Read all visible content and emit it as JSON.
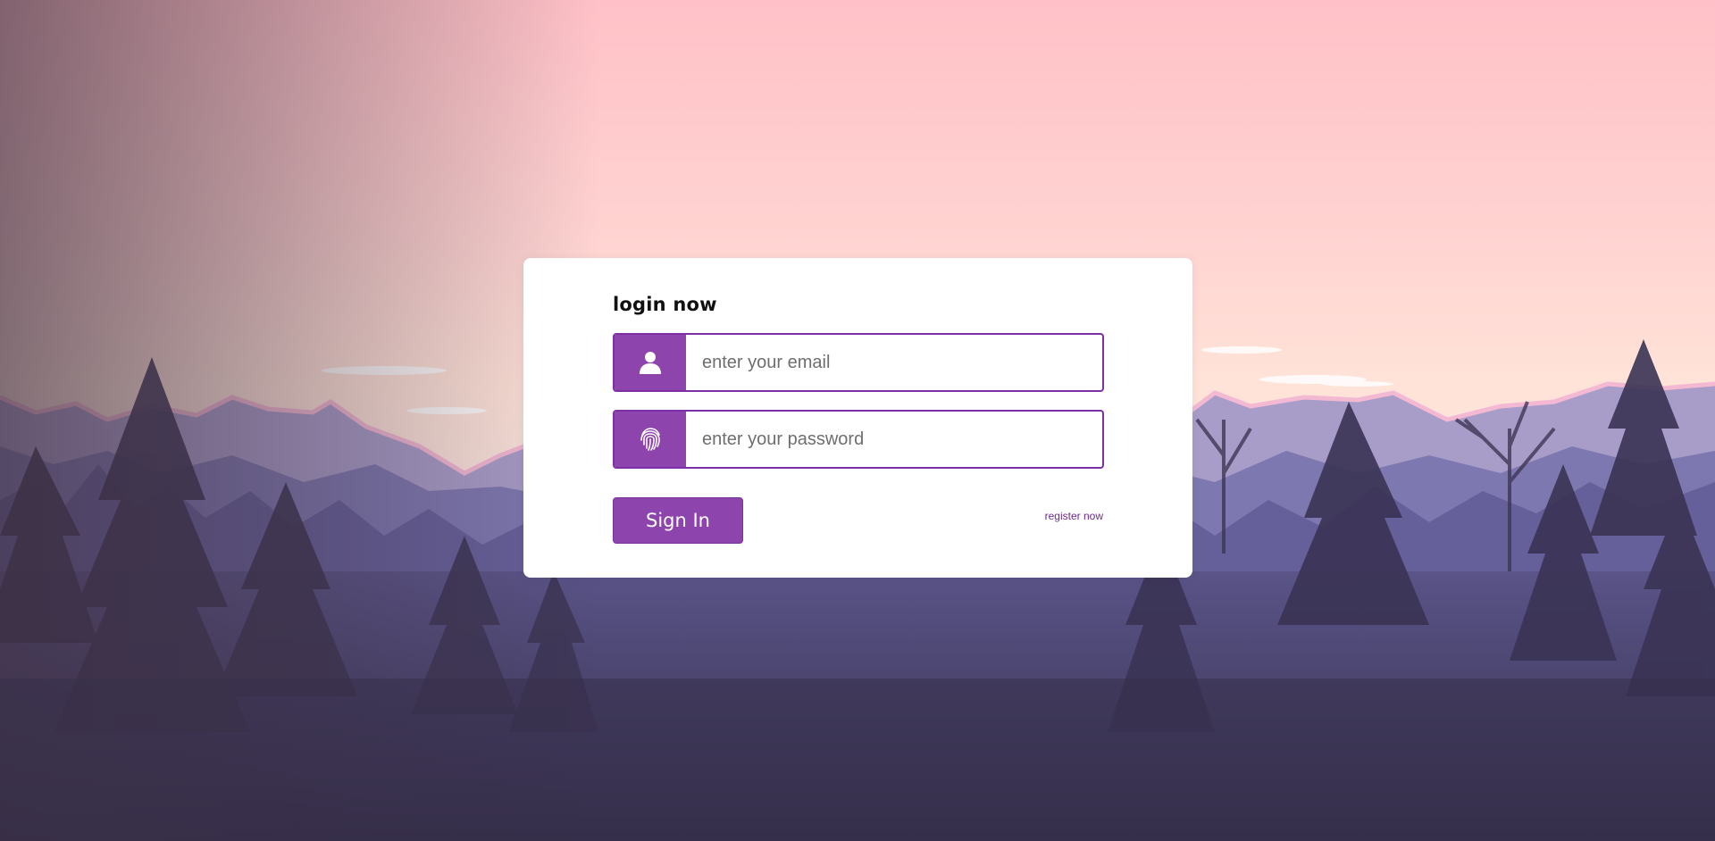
{
  "login": {
    "title": "login now",
    "email_placeholder": "enter your email",
    "email_value": "",
    "password_placeholder": "enter your password",
    "password_value": "",
    "email_icon": "user-icon",
    "password_icon": "fingerprint-icon",
    "sign_in_label": "Sign In",
    "register_label": "register now"
  },
  "colors": {
    "accent": "#8e44ad",
    "accent_border": "#7d2fa6",
    "card": "#ffffff",
    "sky_top": "#ffc3c8",
    "forest_dark": "#3a3352"
  }
}
